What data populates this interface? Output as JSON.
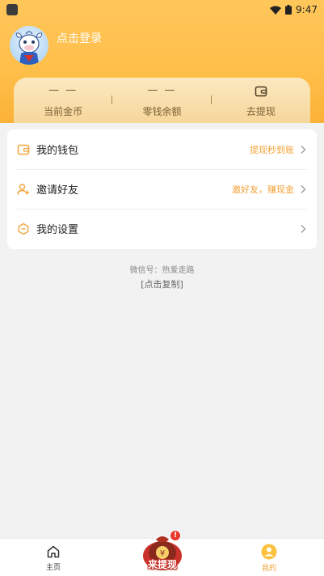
{
  "status_bar": {
    "time": "9:47"
  },
  "profile": {
    "login_label": "点击登录"
  },
  "stats": [
    {
      "value": "— —",
      "label": "当前金币"
    },
    {
      "value": "— —",
      "label": "零钱余额"
    },
    {
      "label": "去提现"
    }
  ],
  "menu": [
    {
      "label": "我的钱包",
      "hint": "提现秒到账",
      "icon": "wallet-icon"
    },
    {
      "label": "邀请好友",
      "hint": "邀好友，赚现金",
      "icon": "add-user-icon"
    },
    {
      "label": "我的设置",
      "hint": "",
      "icon": "settings-icon"
    }
  ],
  "footer_info": {
    "wechat": "微信号：热爱走路",
    "copy": "[点击复制]"
  },
  "tabbar": {
    "home": "主页",
    "center": "来提现",
    "center_badge": "!",
    "mine": "我的"
  },
  "colors": {
    "accent": "#f2a33a",
    "header": "#ffc65a",
    "badge": "#e83a2c"
  }
}
